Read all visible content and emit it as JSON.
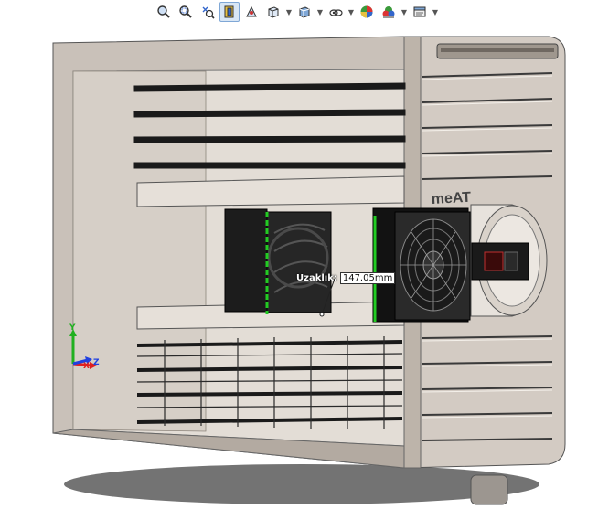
{
  "toolbar": {
    "items": [
      {
        "icon": "zoom-to-fit-icon"
      },
      {
        "icon": "zoom-to-area-icon"
      },
      {
        "icon": "previous-view-icon"
      },
      {
        "icon": "section-view-icon",
        "active": true
      },
      {
        "icon": "dynamic-annotation-icon"
      },
      {
        "icon": "view-orientation-icon",
        "dropdown": true
      },
      {
        "icon": "display-style-icon",
        "dropdown": true
      },
      {
        "icon": "hide-show-items-icon",
        "dropdown": true
      },
      {
        "icon": "edit-appearance-icon",
        "dropdown": false
      },
      {
        "icon": "apply-scene-icon",
        "dropdown": true
      },
      {
        "icon": "view-settings-icon",
        "dropdown": true
      }
    ]
  },
  "model": {
    "logo_text": "meAT"
  },
  "measurement": {
    "label": "Uzaklık:",
    "value": "147.05mm"
  },
  "triad": {
    "x_label": "X",
    "y_label": "Y",
    "z_label": "Z"
  },
  "colors": {
    "case_light": "#d8d0c8",
    "case_mid": "#bfb6ad",
    "case_dark": "#8f877f",
    "rail": "#1a1a1a",
    "highlight": "#22cc22",
    "axis_x": "#e02020",
    "axis_y": "#20b020",
    "axis_z": "#2040e0"
  }
}
